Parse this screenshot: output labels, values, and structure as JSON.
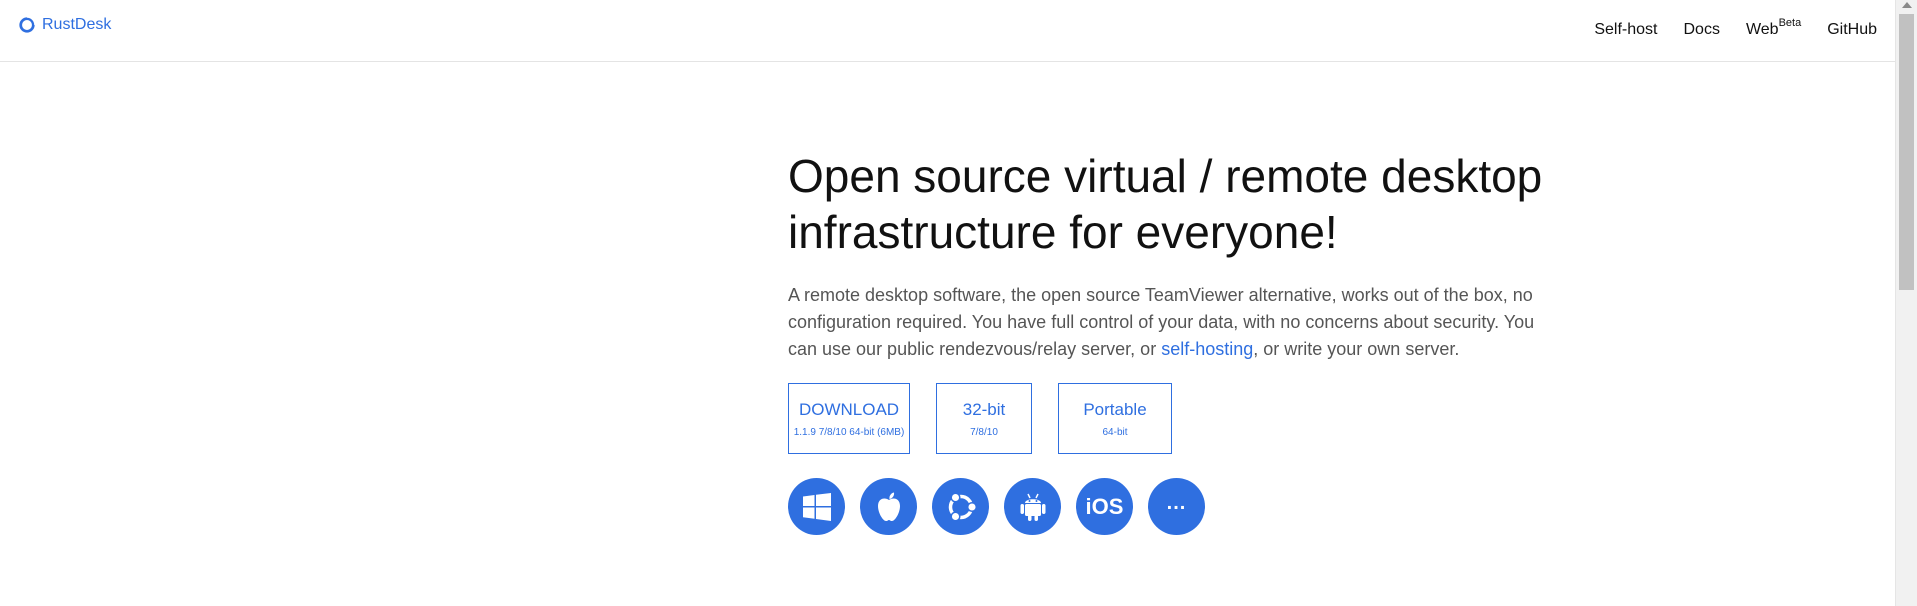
{
  "brand": {
    "name": "RustDesk"
  },
  "nav": {
    "self_host": "Self-host",
    "docs": "Docs",
    "web": "Web",
    "web_badge": "Beta",
    "github": "GitHub"
  },
  "hero": {
    "title_line1": "Open source virtual / remote desktop",
    "title_line2": "infrastructure for everyone!",
    "desc_part1": "A remote desktop software, the open source TeamViewer alternative, works out of the box, no configuration required. You have full control of your data, with no concerns about security. You can use our public rendezvous/relay server, or ",
    "desc_link": "self-hosting",
    "desc_part2": ", or write your own server."
  },
  "downloads": {
    "main_label": "DOWNLOAD",
    "main_sub": "1.1.9 7/8/10 64-bit (6MB)",
    "x32_label": "32-bit",
    "x32_sub": "7/8/10",
    "portable_label": "Portable",
    "portable_sub": "64-bit"
  },
  "platforms": {
    "items": [
      "windows-icon",
      "apple-icon",
      "ubuntu-icon",
      "android-icon",
      "ios-icon",
      "more-icon"
    ],
    "ios_label": "iOS",
    "more_label": "..."
  },
  "colors": {
    "accent": "#2f6fe0",
    "text": "#111111",
    "muted": "#555555"
  }
}
